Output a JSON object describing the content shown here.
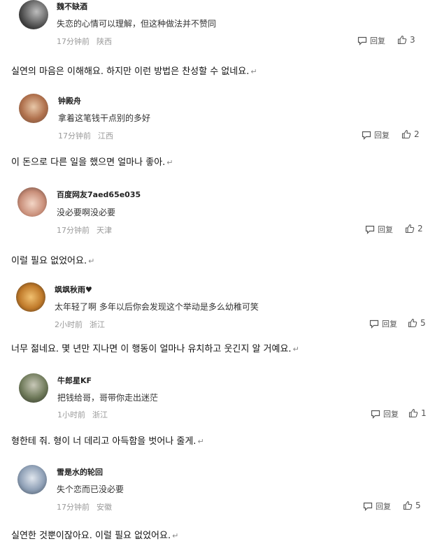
{
  "comments": [
    {
      "username": "魏不缺酒",
      "text": "失恋的心情可以理解，但这种做法并不赞同",
      "time": "17分钟前",
      "location": "陕西",
      "reply_label": "回复",
      "likes": "3"
    },
    {
      "username": "钟殿舟",
      "text": "拿着这笔钱干点别的多好",
      "time": "17分钟前",
      "location": "江西",
      "reply_label": "回复",
      "likes": "2"
    },
    {
      "username": "百度网友7aed65e035",
      "text": "没必要啊没必要",
      "time": "17分钟前",
      "location": "天津",
      "reply_label": "回复",
      "likes": "2"
    },
    {
      "username": "飒飒秋雨♥",
      "text": "太年轻了啊 多年以后你会发现这个举动是多么幼稚可笑",
      "time": "2小时前",
      "location": "浙江",
      "reply_label": "回复",
      "likes": "5"
    },
    {
      "username": "牛郎星KF",
      "text": "把钱给哥，哥带你走出迷茫",
      "time": "1小时前",
      "location": "浙江",
      "reply_label": "回复",
      "likes": "1"
    },
    {
      "username": "雪是水的轮回",
      "text": "失个恋而已没必要",
      "time": "17分钟前",
      "location": "安徽",
      "reply_label": "回复",
      "likes": "5"
    }
  ],
  "translations": [
    "실연의 마음은 이해해요. 하지만 이런 방법은 찬성할 수 없네요.",
    "이 돈으로 다른 일을 했으면 얼마나 좋아.",
    "이럴 필요 없었어요.",
    "너무 젊네요. 몇 년만 지나면 이 행동이 얼마나 유치하고 웃긴지 알 거예요.",
    "형한테 줘. 형이 너 데리고 아득함을 벗어나 줄게.",
    "실연한 것뿐이잖아요. 이럴 필요 없었어요."
  ],
  "paragraph_mark": "↵",
  "colors": {
    "meta": "#9a9a9a",
    "text": "#333333",
    "name": "#222222"
  }
}
